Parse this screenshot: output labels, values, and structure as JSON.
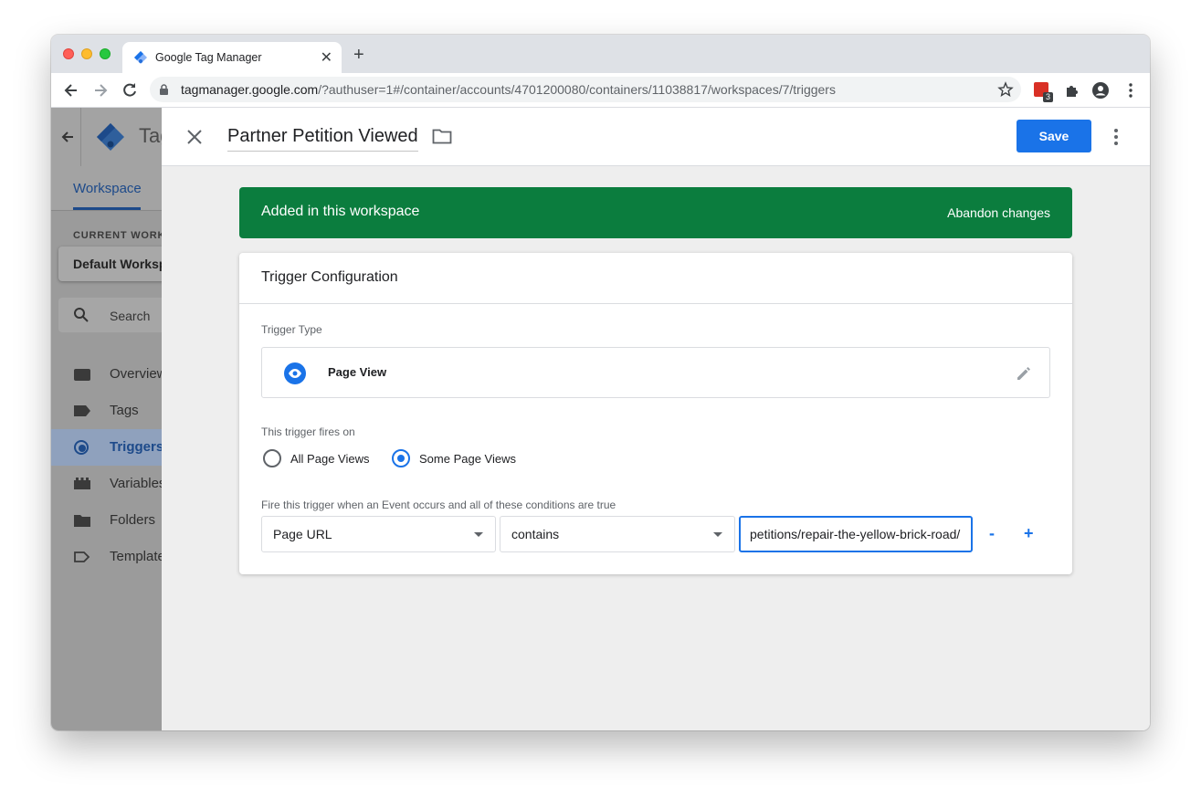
{
  "browser": {
    "tab_title": "Google Tag Manager",
    "new_tab": "+",
    "tab_close": "✕",
    "url_host": "tagmanager.google.com",
    "url_path": "/?authuser=1#/container/accounts/4701200080/containers/11038817/workspaces/7/triggers",
    "extension_badge_count": "3"
  },
  "sidebar": {
    "brand": "Tag Manager",
    "tab": "Workspace",
    "current_workspace_label": "CURRENT WORKSPACE",
    "current_workspace": "Default Workspace",
    "search_placeholder": "Search",
    "items": [
      {
        "label": "Overview",
        "icon": "overview-icon"
      },
      {
        "label": "Tags",
        "icon": "tag-icon"
      },
      {
        "label": "Triggers",
        "icon": "trigger-icon",
        "active": true
      },
      {
        "label": "Variables",
        "icon": "variables-icon"
      },
      {
        "label": "Folders",
        "icon": "folder-icon"
      },
      {
        "label": "Templates",
        "icon": "template-icon"
      }
    ]
  },
  "panel": {
    "trigger_name": "Partner Petition Viewed",
    "save_label": "Save",
    "banner_message": "Added in this workspace",
    "banner_action": "Abandon changes",
    "card_title": "Trigger Configuration",
    "trigger_type_label": "Trigger Type",
    "trigger_type": "Page View",
    "fires_on_label": "This trigger fires on",
    "fires_on_options": [
      "All Page Views",
      "Some Page Views"
    ],
    "fires_on_selected": "Some Page Views",
    "condition_label": "Fire this trigger when an Event occurs and all of these conditions are true",
    "condition": {
      "variable": "Page URL",
      "operator": "contains",
      "value": "/petitions/repair-the-yellow-brick-road"
    },
    "remove_condition": "-",
    "add_condition": "+"
  },
  "colors": {
    "accent": "#1a73e8",
    "banner": "#0b7d3e"
  }
}
